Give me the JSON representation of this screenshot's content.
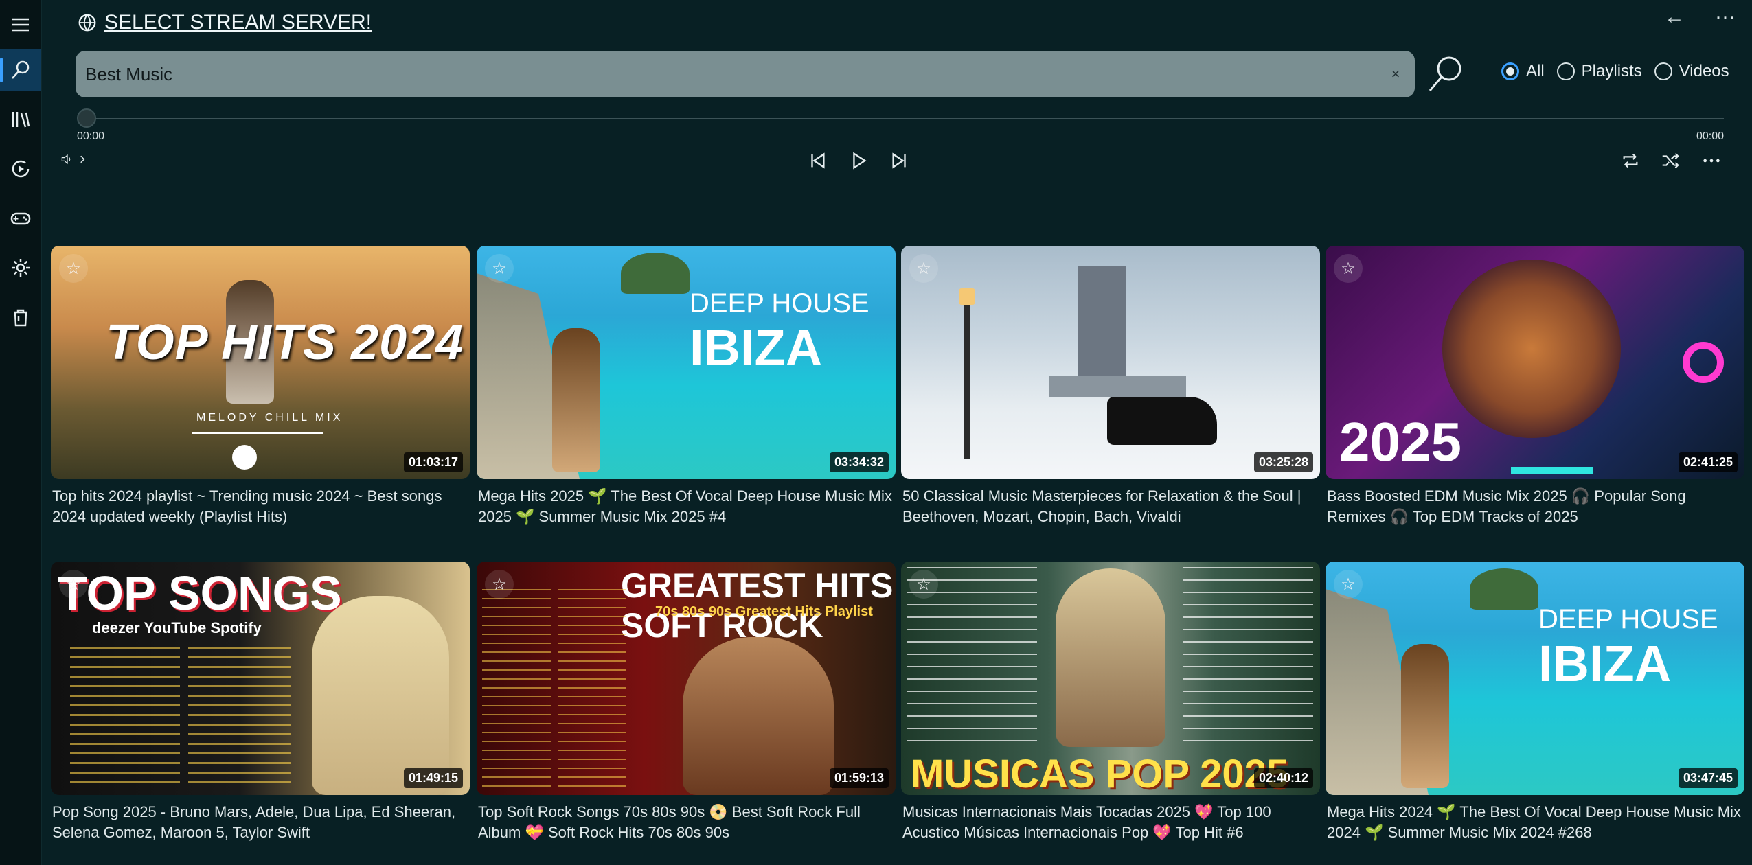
{
  "app": {
    "server_label": "SELECT STREAM SERVER!",
    "back_icon": "back-arrow-icon",
    "more_icon": "more-icon"
  },
  "sidebar": [
    {
      "icon": "menu-icon",
      "active": false
    },
    {
      "icon": "search-icon",
      "active": true
    },
    {
      "icon": "library-icon",
      "active": false
    },
    {
      "icon": "now-playing-icon",
      "active": false
    },
    {
      "icon": "gamepad-icon",
      "active": false
    },
    {
      "icon": "settings-icon",
      "active": false
    },
    {
      "icon": "bag-icon",
      "active": false
    }
  ],
  "search": {
    "value": "Best Music",
    "clear_glyph": "×",
    "filters": [
      {
        "label": "All",
        "selected": true
      },
      {
        "label": "Playlists",
        "selected": false
      },
      {
        "label": "Videos",
        "selected": false
      }
    ]
  },
  "player": {
    "elapsed": "00:00",
    "total": "00:00",
    "progress": 0
  },
  "videos": [
    {
      "title": "Top hits 2024 playlist  ~ Trending music 2024 ~ Best songs 2024 updated weekly (Playlist Hits)",
      "duration": "01:03:17",
      "overlay": "TOP HITS 2024",
      "sub": "MELODY CHILL MIX"
    },
    {
      "title": "Mega Hits 2025 🌱 The Best Of Vocal Deep House Music Mix 2025 🌱 Summer Music Mix 2025 #4",
      "duration": "03:34:32",
      "overlay": "DEEP HOUSE",
      "sub": "IBIZA"
    },
    {
      "title": "50 Classical Music Masterpieces for Relaxation & the Soul | Beethoven, Mozart, Chopin, Bach, Vivaldi",
      "duration": "03:25:28",
      "overlay": "",
      "sub": ""
    },
    {
      "title": "Bass Boosted EDM Music Mix 2025 🎧 Popular Song Remixes 🎧 Top EDM Tracks of 2025",
      "duration": "02:41:25",
      "overlay": "2025",
      "sub": ""
    },
    {
      "title": "Pop Song 2025 - Bruno Mars, Adele, Dua Lipa, Ed Sheeran, Selena Gomez, Maroon 5, Taylor Swift",
      "duration": "01:49:15",
      "overlay": "TOP SONGS",
      "sub": "deezer  YouTube  Spotify"
    },
    {
      "title": "Top Soft Rock Songs 70s 80s 90s 📀 Best Soft Rock Full Album 💝 Soft Rock Hits 70s 80s 90s",
      "duration": "01:59:13",
      "overlay": "GREATEST HITS SOFT ROCK",
      "sub": "70s 80s 90s Greatest Hits Playlist"
    },
    {
      "title": "Musicas Internacionais Mais Tocadas 2025 💖 Top 100 Acustico Músicas Internacionais Pop 💖 Top Hit #6",
      "duration": "02:40:12",
      "overlay": "MUSICAS POP 2025",
      "sub": ""
    },
    {
      "title": "Mega Hits 2024 🌱 The Best Of Vocal Deep House Music Mix 2024 🌱 Summer Music Mix 2024 #268",
      "duration": "03:47:45",
      "overlay": "DEEP HOUSE",
      "sub": "IBIZA"
    }
  ]
}
